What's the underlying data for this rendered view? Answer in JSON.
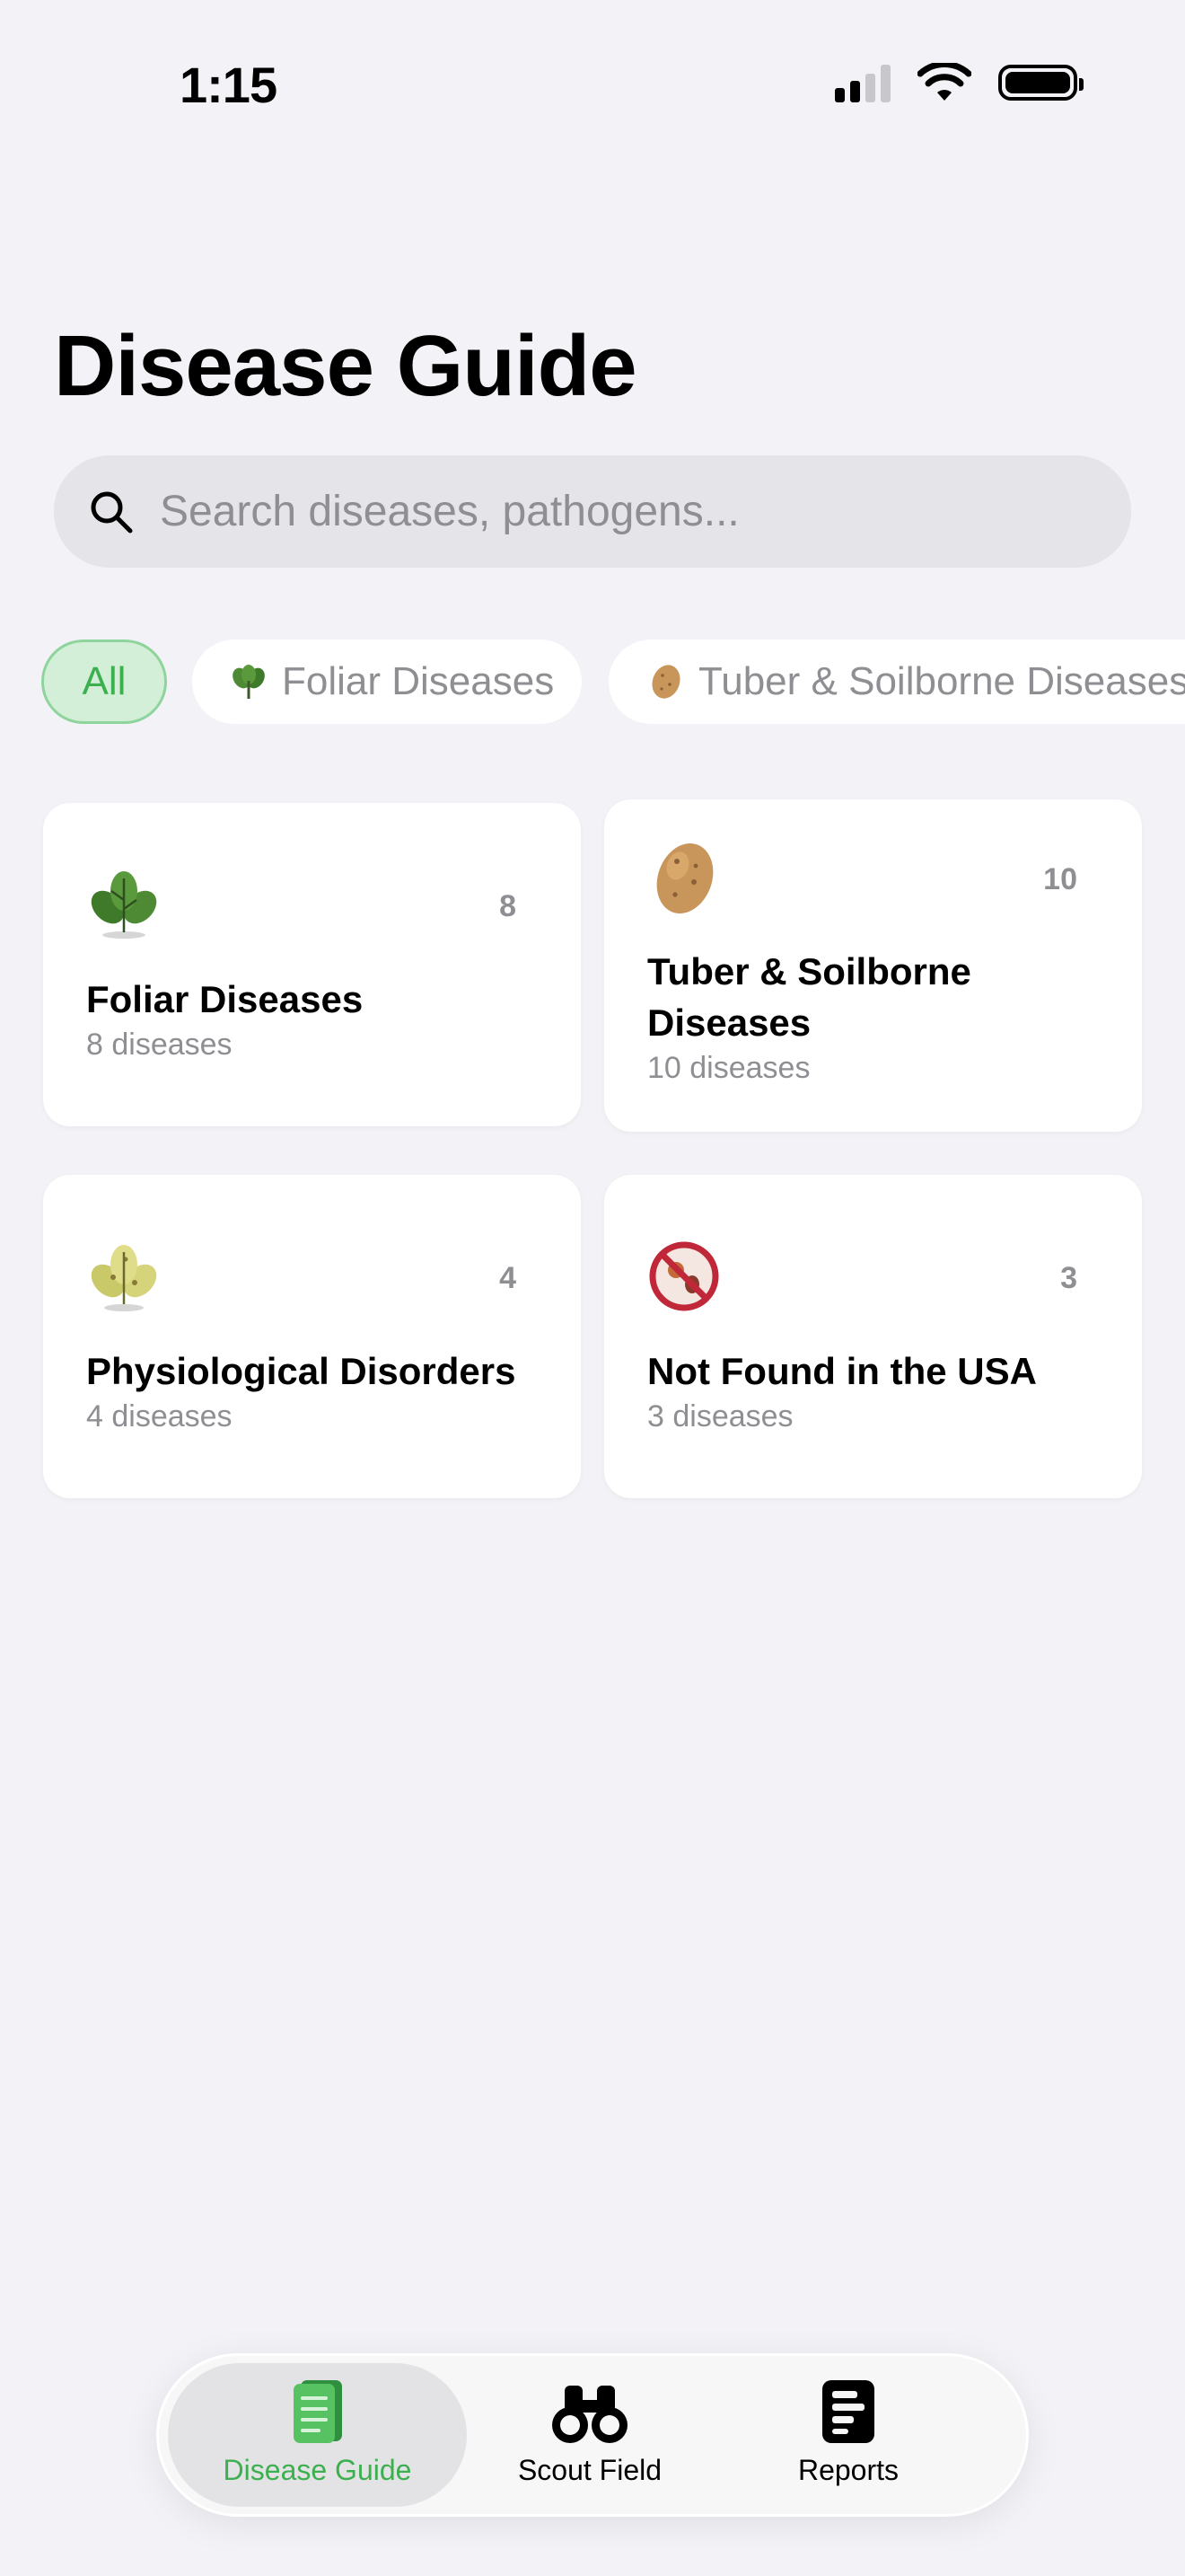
{
  "status_bar": {
    "time": "1:15"
  },
  "header": {
    "title": "Disease Guide"
  },
  "search": {
    "placeholder": "Search diseases, pathogens..."
  },
  "filters": [
    {
      "label": "All",
      "active": true
    },
    {
      "label": "Foliar Diseases",
      "icon": "leaf-icon",
      "active": false
    },
    {
      "label": "Tuber & Soilborne Diseases",
      "icon": "potato-icon",
      "active": false
    }
  ],
  "categories": [
    {
      "name": "Foliar Diseases",
      "count": "8",
      "subtitle": "8 diseases",
      "icon": "leaf-icon"
    },
    {
      "name": "Tuber & Soilborne Diseases",
      "count": "10",
      "subtitle": "10 diseases",
      "icon": "potato-icon"
    },
    {
      "name": "Physiological Disorders",
      "count": "4",
      "subtitle": "4 diseases",
      "icon": "yellow-leaf-icon"
    },
    {
      "name": "Not Found in the USA",
      "count": "3",
      "subtitle": "3 diseases",
      "icon": "no-pathogen-icon"
    }
  ],
  "tabs": [
    {
      "label": "Disease Guide",
      "icon": "book-icon",
      "active": true
    },
    {
      "label": "Scout Field",
      "icon": "binoculars-icon",
      "active": false
    },
    {
      "label": "Reports",
      "icon": "report-icon",
      "active": false
    }
  ],
  "colors": {
    "accent": "#3cb04f",
    "background": "#f2f2f7",
    "chip_active_bg": "#d3efd8"
  }
}
